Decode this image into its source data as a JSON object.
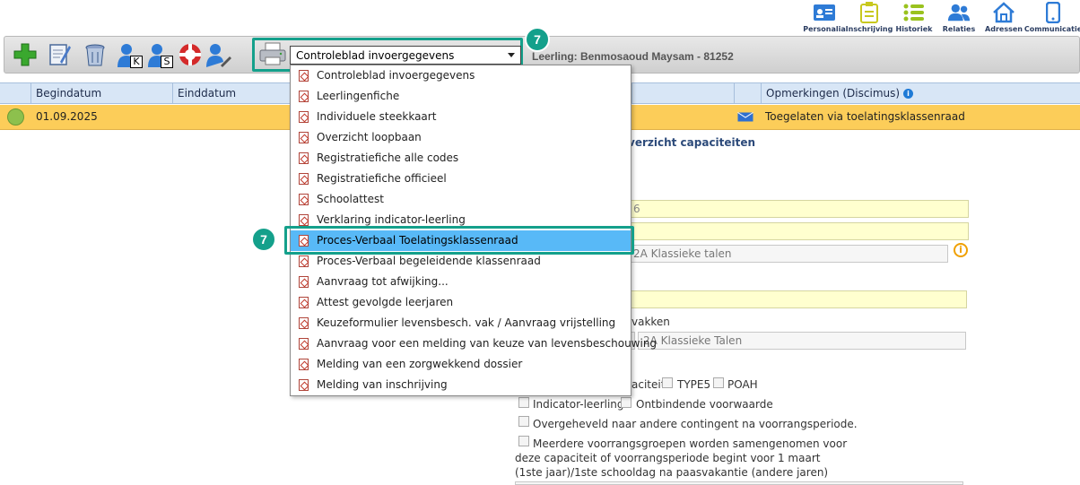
{
  "nav": {
    "items": [
      {
        "label": "Personalia",
        "icon": "id-card-icon"
      },
      {
        "label": "Inschrijving",
        "icon": "clipboard-icon"
      },
      {
        "label": "Historiek",
        "icon": "list-icon"
      },
      {
        "label": "Relaties",
        "icon": "people-icon"
      },
      {
        "label": "Adressen",
        "icon": "house-icon"
      },
      {
        "label": "Communicatie",
        "icon": "phone-icon"
      }
    ]
  },
  "toolbar": {
    "buttons": [
      {
        "name": "add-button",
        "icon": "plus-icon"
      },
      {
        "name": "edit-button",
        "icon": "notepad-icon"
      },
      {
        "name": "delete-button",
        "icon": "trash-icon"
      },
      {
        "name": "user-k-button",
        "icon": "user-icon",
        "sub": "K"
      },
      {
        "name": "user-s-button",
        "icon": "user-icon",
        "sub": "S"
      },
      {
        "name": "lifebuoy-button",
        "icon": "lifebuoy-icon"
      },
      {
        "name": "user-edit-button",
        "icon": "user-edit-icon"
      }
    ],
    "select_value": "Controleblad invoergegevens",
    "student_label": "Leerling: Benmosaoud Maysam - 81252",
    "badge_number": "7"
  },
  "table": {
    "headers": [
      "Begindatum",
      "Einddatum",
      "Opmerkingen (Discimus)"
    ],
    "row": {
      "begindatum": "01.09.2025",
      "opmerking": "Toegelaten via toelatingsklassenraad"
    }
  },
  "form": {
    "section_title": "verzicht capaciteiten",
    "field1_value": "6",
    "field3_value": "2A Klassieke talen",
    "vakken_label": "vakken",
    "field5_value": "2A Klassieke Talen",
    "capaciteit_label": "aciteit",
    "type5_label": "TYPE5",
    "poah_label": "POAH",
    "indicator_label": "Indicator-leerling",
    "ontbindende_label": "Ontbindende voorwaarde",
    "overgeheveld_label": "Overgeheveld naar andere contingent na voorrangsperiode.",
    "meerdere_line1": "Meerdere voorrangsgroepen worden samengenomen voor",
    "meerdere_line2": "deze capaciteit of voorrangsperiode begint voor 1 maart",
    "meerdere_line3": "(1ste jaar)/1ste schooldag na paasvakantie (andere jaren)"
  },
  "dropdown": {
    "items": [
      "Controleblad invoergegevens",
      "Leerlingenfiche",
      "Individuele steekkaart",
      "Overzicht loopbaan",
      "Registratiefiche alle codes",
      "Registratiefiche officieel",
      "Schoolattest",
      "Verklaring indicator-leerling",
      "Proces-Verbaal Toelatingsklassenraad",
      "Proces-Verbaal begeleidende klassenraad",
      "Aanvraag tot afwijking...",
      "Attest gevolgde leerjaren",
      "Keuzeformulier levensbesch. vak / Aanvraag vrijstelling",
      "Aanvraag voor een melding van keuze van levensbeschouwing",
      "Melding van een zorgwekkend dossier",
      "Melding van inschrijving"
    ],
    "selected_index": 8
  },
  "colors": {
    "accent": "#14a08b",
    "row_highlight": "#fccd59",
    "selected_item": "#58b9f7",
    "header_bg": "#d8e6f6"
  }
}
